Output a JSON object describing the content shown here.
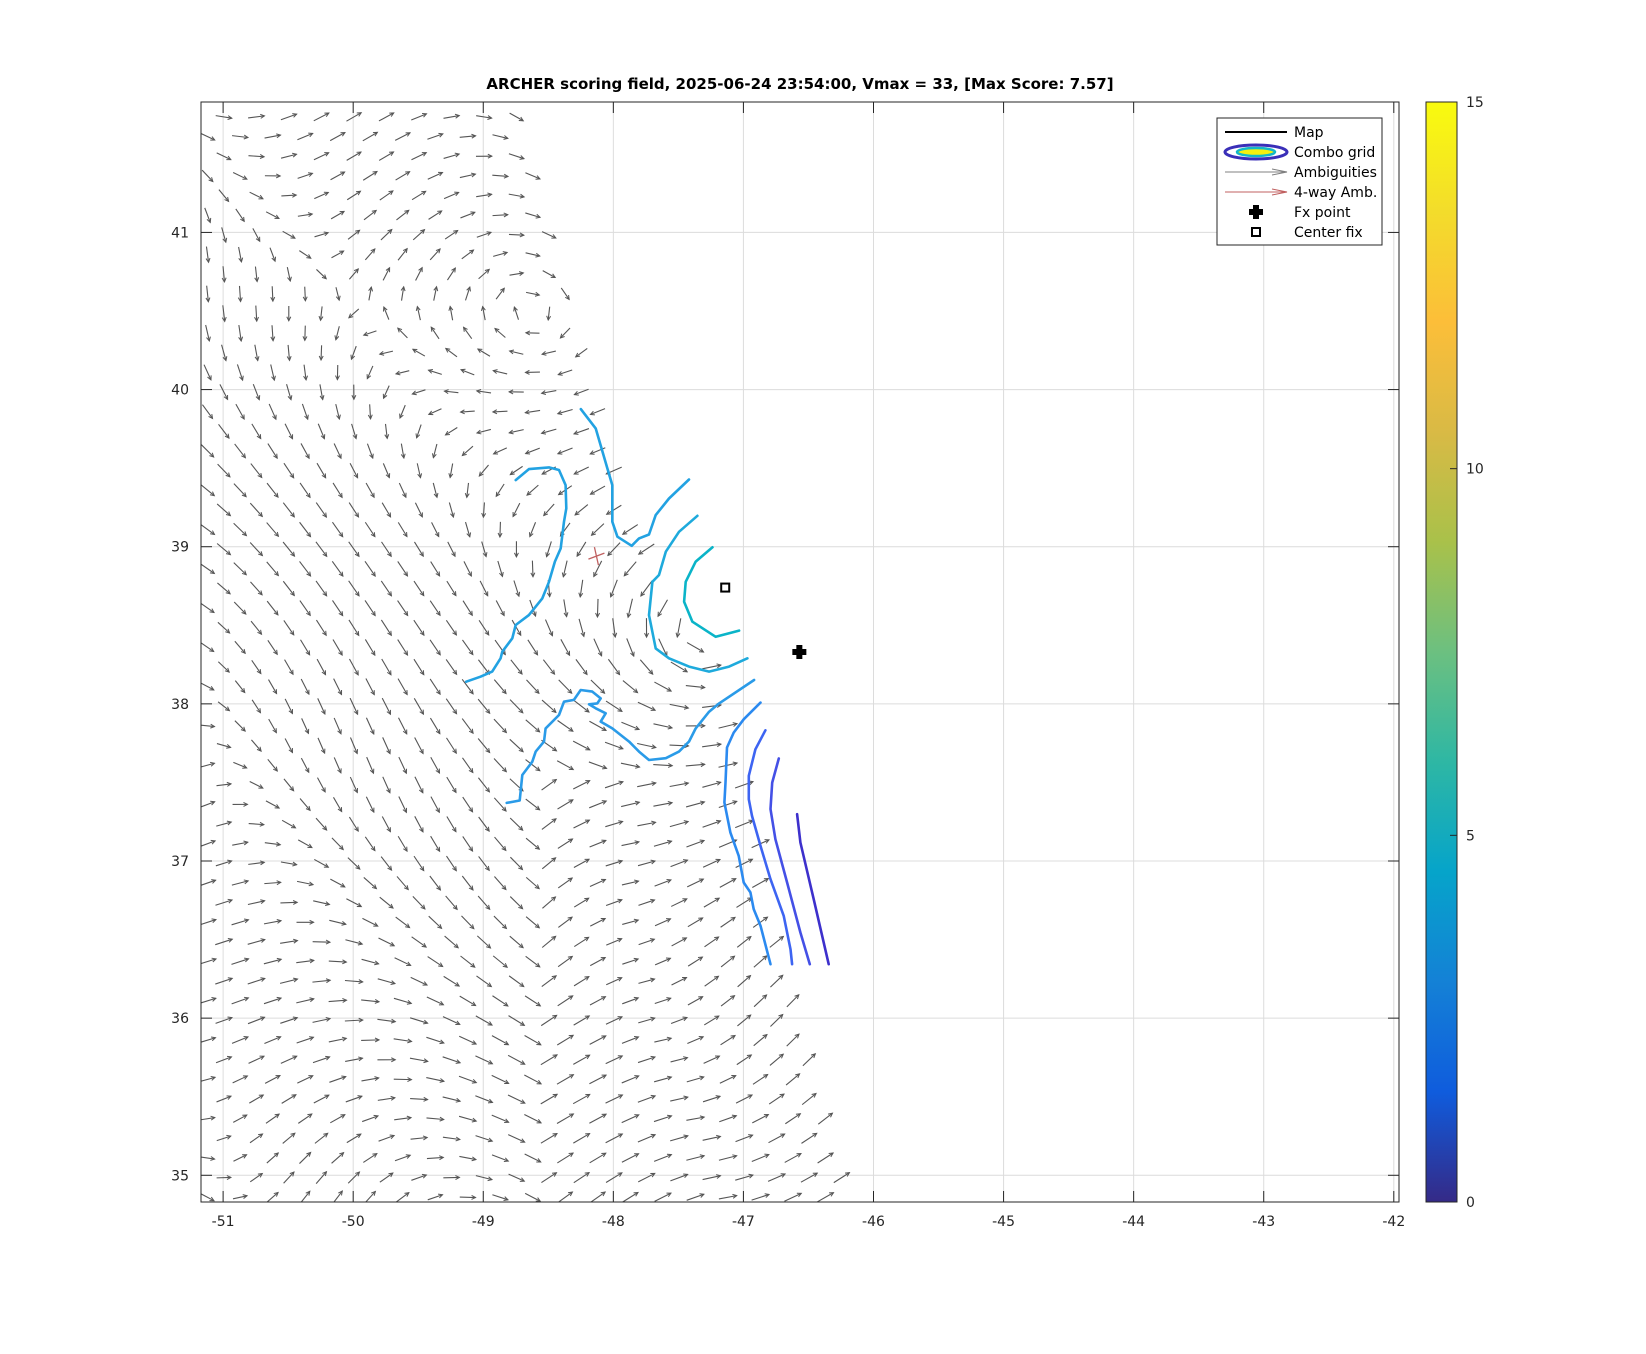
{
  "chart_data": {
    "type": "contour+quiver",
    "title": "ARCHER scoring field, 2025-06-24 23:54:00, Vmax = 33, [Max Score: 7.57]",
    "xlabel": "",
    "ylabel": "",
    "xlim": [
      -51.17,
      -41.96
    ],
    "ylim": [
      34.83,
      41.83
    ],
    "xticks": [
      -51,
      -50,
      -49,
      -48,
      -47,
      -46,
      -45,
      -44,
      -43,
      -42
    ],
    "yticks": [
      35,
      36,
      37,
      38,
      39,
      40,
      41
    ],
    "grid": true,
    "colorbar": {
      "min": 0,
      "max": 15,
      "ticks": [
        0,
        5,
        10,
        15
      ],
      "colormap": "parula"
    },
    "legend": {
      "placement": "top-right",
      "entries": [
        {
          "label": "Map",
          "kind": "line",
          "color": "#000000"
        },
        {
          "label": "Combo grid",
          "kind": "ellipse"
        },
        {
          "label": "Ambiguities",
          "kind": "arrow",
          "color": "#808080"
        },
        {
          "label": "4-way Amb.",
          "kind": "arrow",
          "color": "#c06060"
        },
        {
          "label": "Fx point",
          "kind": "plus-marker"
        },
        {
          "label": "Center fix",
          "kind": "square-marker"
        }
      ]
    },
    "fx_point": {
      "lon": -46.57,
      "lat": 38.33
    },
    "center_fix": {
      "lon": -47.14,
      "lat": 38.74
    },
    "four_way_amb": [
      {
        "lon": -48.13,
        "lat": 38.94
      }
    ],
    "contours": [
      {
        "level": 5.6,
        "color": "#22a2e2",
        "points": [
          [
            -48.25,
            39.876
          ],
          [
            -48.136,
            39.753
          ],
          [
            -48.046,
            39.498
          ],
          [
            -48.008,
            39.392
          ],
          [
            -48.008,
            39.159
          ],
          [
            -47.969,
            39.064
          ],
          [
            -47.859,
            39.006
          ],
          [
            -47.803,
            39.053
          ],
          [
            -47.726,
            39.078
          ],
          [
            -47.674,
            39.201
          ],
          [
            -47.572,
            39.307
          ],
          [
            -47.418,
            39.428
          ]
        ]
      },
      {
        "level": 5.6,
        "color": "#22a2e2",
        "points": [
          [
            -48.751,
            39.424
          ],
          [
            -48.649,
            39.494
          ],
          [
            -48.495,
            39.505
          ],
          [
            -48.418,
            39.488
          ],
          [
            -48.367,
            39.392
          ],
          [
            -48.362,
            39.244
          ],
          [
            -48.379,
            39.159
          ],
          [
            -48.405,
            38.989
          ],
          [
            -48.449,
            38.905
          ],
          [
            -48.495,
            38.777
          ],
          [
            -48.546,
            38.671
          ],
          [
            -48.649,
            38.565
          ],
          [
            -48.751,
            38.502
          ],
          [
            -48.777,
            38.417
          ],
          [
            -48.854,
            38.332
          ],
          [
            -48.867,
            38.29
          ],
          [
            -48.931,
            38.205
          ],
          [
            -49.021,
            38.173
          ],
          [
            -49.131,
            38.141
          ]
        ]
      },
      {
        "level": 6.8,
        "color": "#0ab4c8",
        "points": [
          [
            -47.238,
            38.996
          ],
          [
            -47.367,
            38.905
          ],
          [
            -47.444,
            38.777
          ],
          [
            -47.456,
            38.65
          ],
          [
            -47.392,
            38.523
          ],
          [
            -47.213,
            38.427
          ],
          [
            -47.033,
            38.466
          ]
        ]
      },
      {
        "level": 6.0,
        "color": "#1eaadc",
        "points": [
          [
            -47.354,
            39.197
          ],
          [
            -47.495,
            39.095
          ],
          [
            -47.597,
            38.968
          ],
          [
            -47.649,
            38.82
          ],
          [
            -47.7,
            38.777
          ],
          [
            -47.726,
            38.565
          ],
          [
            -47.674,
            38.353
          ],
          [
            -47.572,
            38.29
          ],
          [
            -47.418,
            38.237
          ],
          [
            -47.264,
            38.205
          ],
          [
            -47.11,
            38.237
          ],
          [
            -46.969,
            38.29
          ]
        ]
      },
      {
        "level": 5.2,
        "color": "#2a9be8",
        "points": [
          [
            -48.82,
            37.37
          ],
          [
            -48.72,
            37.385
          ],
          [
            -48.7,
            37.547
          ],
          [
            -48.623,
            37.632
          ],
          [
            -48.597,
            37.696
          ],
          [
            -48.533,
            37.76
          ],
          [
            -48.521,
            37.844
          ],
          [
            -48.418,
            37.929
          ],
          [
            -48.379,
            38.014
          ],
          [
            -48.303,
            38.025
          ],
          [
            -48.251,
            38.088
          ],
          [
            -48.162,
            38.078
          ],
          [
            -48.097,
            38.035
          ],
          [
            -48.123,
            38.003
          ],
          [
            -48.187,
            37.997
          ],
          [
            -48.136,
            37.972
          ],
          [
            -48.059,
            37.94
          ],
          [
            -48.097,
            37.887
          ],
          [
            -48.008,
            37.844
          ],
          [
            -47.879,
            37.76
          ],
          [
            -47.803,
            37.696
          ],
          [
            -47.726,
            37.643
          ],
          [
            -47.597,
            37.654
          ],
          [
            -47.495,
            37.696
          ],
          [
            -47.418,
            37.76
          ],
          [
            -47.367,
            37.844
          ],
          [
            -47.264,
            37.95
          ],
          [
            -47.187,
            38.003
          ],
          [
            -46.918,
            38.152
          ]
        ]
      },
      {
        "level": 4.5,
        "color": "#2b8af0",
        "points": [
          [
            -46.869,
            38.008
          ],
          [
            -46.998,
            37.902
          ],
          [
            -47.075,
            37.817
          ],
          [
            -47.126,
            37.722
          ],
          [
            -47.138,
            37.499
          ],
          [
            -47.146,
            37.372
          ],
          [
            -47.1,
            37.181
          ],
          [
            -47.036,
            37.033
          ],
          [
            -46.998,
            36.863
          ],
          [
            -46.946,
            36.8
          ],
          [
            -46.921,
            36.694
          ],
          [
            -46.869,
            36.588
          ],
          [
            -46.792,
            36.343
          ]
        ]
      },
      {
        "level": 3.5,
        "color": "#3d64f2",
        "points": [
          [
            -46.831,
            37.832
          ],
          [
            -46.908,
            37.711
          ],
          [
            -46.959,
            37.542
          ],
          [
            -46.959,
            37.393
          ],
          [
            -46.934,
            37.287
          ],
          [
            -46.869,
            37.096
          ],
          [
            -46.792,
            36.884
          ],
          [
            -46.69,
            36.651
          ],
          [
            -46.638,
            36.439
          ],
          [
            -46.626,
            36.343
          ]
        ]
      },
      {
        "level": 2.5,
        "color": "#4450e6",
        "points": [
          [
            -46.728,
            37.652
          ],
          [
            -46.779,
            37.499
          ],
          [
            -46.792,
            37.33
          ],
          [
            -46.754,
            37.139
          ],
          [
            -46.664,
            36.863
          ],
          [
            -46.562,
            36.545
          ],
          [
            -46.49,
            36.343
          ]
        ]
      },
      {
        "level": 1.5,
        "color": "#3d30cc",
        "points": [
          [
            -46.587,
            37.298
          ],
          [
            -46.562,
            37.118
          ],
          [
            -46.46,
            36.757
          ],
          [
            -46.344,
            36.343
          ]
        ]
      }
    ],
    "ambiguities": {
      "grid_step_lon": 0.25,
      "grid_step_lat": 0.125,
      "swath_east_edge": [
        [
          -48.72,
          41.83
        ],
        [
          -48.23,
          40.34
        ],
        [
          -47.87,
          39.28
        ],
        [
          -47.14,
          38.21
        ],
        [
          -46.66,
          36.6
        ],
        [
          -46.13,
          34.83
        ]
      ],
      "vortex_center": [
        -47.3,
        38.45
      ],
      "background_dir_deg": 40
    }
  }
}
